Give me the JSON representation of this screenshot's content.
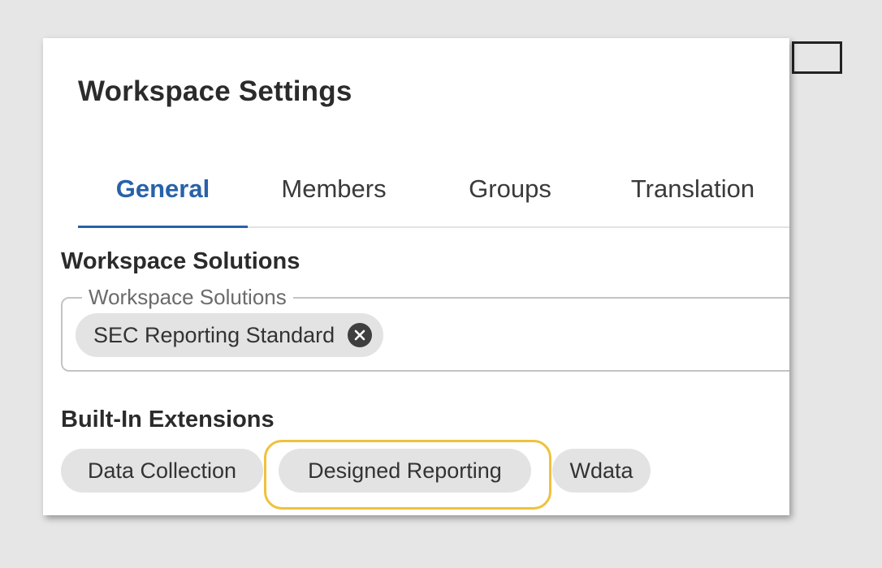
{
  "dialog": {
    "title": "Workspace Settings"
  },
  "tabs": [
    {
      "label": "General",
      "active": true
    },
    {
      "label": "Members",
      "active": false
    },
    {
      "label": "Groups",
      "active": false
    },
    {
      "label": "Translation",
      "active": false
    }
  ],
  "workspace_solutions": {
    "heading": "Workspace Solutions",
    "field_label": "Workspace Solutions",
    "selected": [
      {
        "label": "SEC Reporting Standard",
        "remove_icon": "close-circle-icon"
      }
    ]
  },
  "built_in_extensions": {
    "heading": "Built-In Extensions",
    "items": [
      {
        "label": "Data Collection"
      },
      {
        "label": "Designed Reporting",
        "highlighted": true
      },
      {
        "label": "Wdata"
      }
    ]
  },
  "colors": {
    "accent": "#2762a9",
    "highlight": "#efc13c",
    "chip_bg": "#e3e3e3",
    "background": "#e6e6e6"
  }
}
